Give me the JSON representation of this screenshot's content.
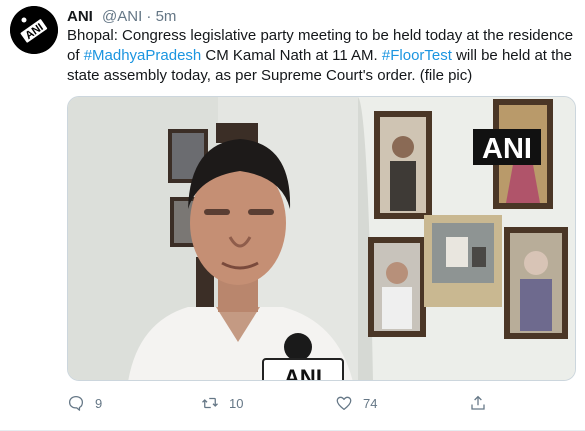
{
  "tweet": {
    "author_name": "ANI",
    "author_handle": "@ANI",
    "separator": "·",
    "time": "5m",
    "text_parts": [
      {
        "text": "Bhopal: Congress legislative party meeting to be held today at the residence of ",
        "type": "plain"
      },
      {
        "text": "#MadhyaPradesh",
        "type": "hashtag"
      },
      {
        "text": " CM Kamal Nath at 11 AM. ",
        "type": "plain"
      },
      {
        "text": "#FloorTest",
        "type": "hashtag"
      },
      {
        "text": " will be held at the state assembly today, as per Supreme Court's order. (file pic)",
        "type": "plain"
      }
    ],
    "avatar_logo_text": "ANI",
    "media": {
      "watermark": "ANI",
      "mic_label": "ANI"
    },
    "actions": {
      "reply_count": "9",
      "retweet_count": "10",
      "like_count": "74"
    }
  },
  "colors": {
    "link": "#1b95e0",
    "muted": "#657786",
    "text": "#14171a"
  },
  "icons": [
    "reply-icon",
    "retweet-icon",
    "like-icon",
    "share-icon"
  ]
}
